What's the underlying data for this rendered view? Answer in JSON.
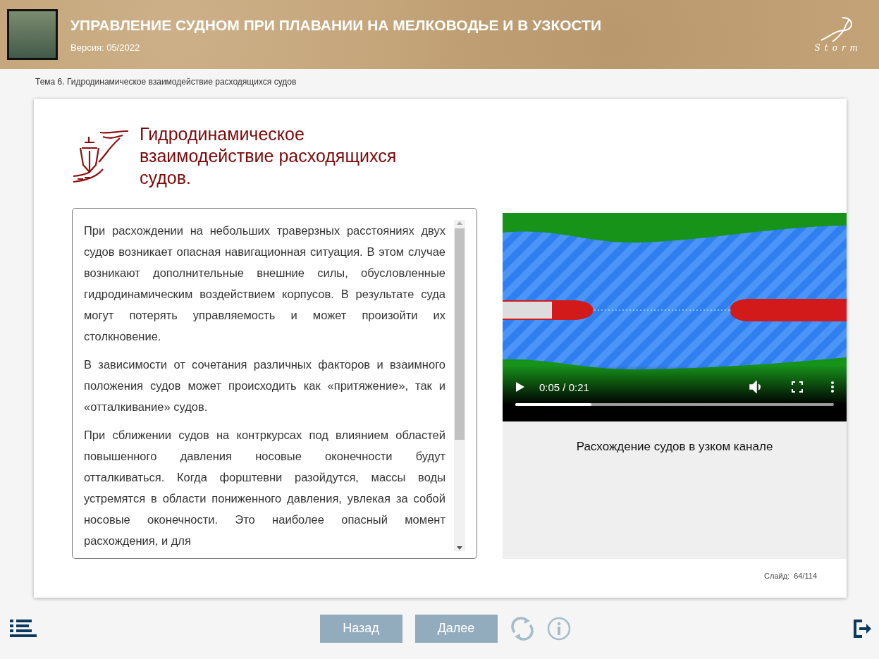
{
  "header": {
    "title": "УПРАВЛЕНИЕ СУДНОМ ПРИ ПЛАВАНИИ НА МЕЛКОВОДЬЕ И В УЗКОСТИ",
    "version": "Версия: 05/2022",
    "logo_text": "Storm"
  },
  "breadcrumb": "Тема 6. Гидродинамическое взаимодействие расходящихся судов",
  "slide": {
    "title": "Гидродинамическое взаимодействие расходящихся судов.",
    "paragraphs": [
      "При расхождении на небольших траверзных расстояниях двух судов возникает опасная навигационная ситуация. В этом случае возникают дополнительные внешние силы, обусловленные гидродинамическим воздействием корпусов. В результате суда могут потерять управляемость и может произойти их столкновение.",
      "В зависимости от сочетания различных факторов и взаимного положения судов может происходить как «притяжение», так и «отталкивание» судов.",
      "При сближении судов на контркурсах под влиянием областей повышенного давления носовые оконечности будут отталкиваться. Когда форштевни разойдутся, массы воды устремятся в области пониженного давления, увлекая за собой носовые оконечности. Это наиболее опасный момент расхождения, и для"
    ],
    "video": {
      "time": "0:05 / 0:21",
      "level": 0.24,
      "caption": "Расхождение судов в узком канале"
    },
    "counter_label": "Слайд:",
    "counter": "64/114"
  },
  "nav": {
    "buttons": [
      "Назад",
      "Далее"
    ]
  }
}
